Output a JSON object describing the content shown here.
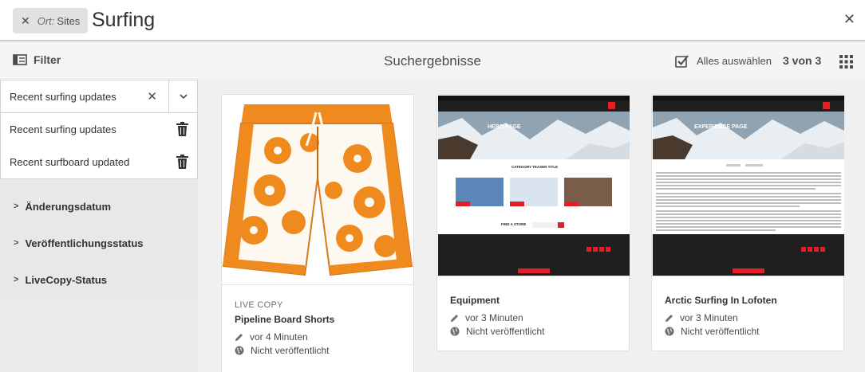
{
  "search": {
    "tag_key": "Ort:",
    "tag_value": "Sites",
    "query": "Surfing"
  },
  "actionbar": {
    "filter_label": "Filter",
    "title": "Suchergebnisse",
    "select_all_label": "Alles auswählen",
    "count": "3 von 3"
  },
  "saved_search": {
    "value": "Recent surfing updates",
    "items": [
      {
        "label": "Recent surfing updates"
      },
      {
        "label": "Recent surfboard updated"
      }
    ]
  },
  "facets": [
    {
      "label": "Änderungsdatum"
    },
    {
      "label": "Veröffentlichungsstatus"
    },
    {
      "label": "LiveCopy-Status"
    }
  ],
  "cards": [
    {
      "context": "LIVE COPY",
      "title": "Pipeline Board Shorts",
      "modified": "vor 4 Minuten",
      "status": "Nicht veröffentlicht"
    },
    {
      "title": "Equipment",
      "modified": "vor 3 Minuten",
      "status": "Nicht veröffentlicht",
      "hero": "HERO PAGE",
      "section": "CATEGORY TEASER TITLE",
      "find": "FIND A STORE"
    },
    {
      "title": "Arctic Surfing In Lofoten",
      "modified": "vor 3 Minuten",
      "status": "Nicht veröffentlicht",
      "hero": "EXPERIENCE PAGE"
    }
  ],
  "colors": {
    "accent": "#e31e26",
    "shorts_orange": "#f08a1c",
    "footer": "#1f1f1f"
  },
  "icons": [
    "close-icon",
    "filter-icon",
    "chevron-down-icon",
    "trash-icon",
    "chevron-right-icon",
    "checkbox-icon",
    "grid-view-icon",
    "pencil-icon",
    "globe-icon"
  ]
}
